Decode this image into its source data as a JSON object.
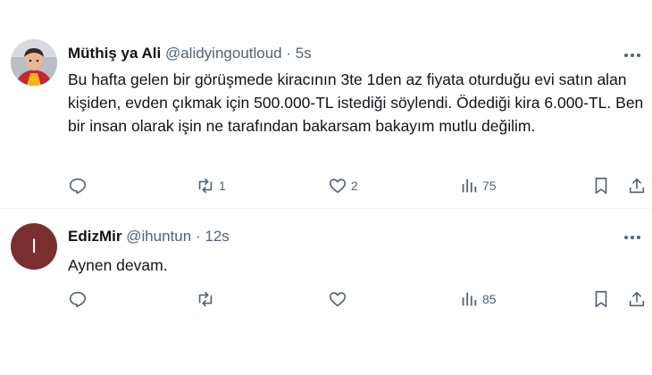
{
  "tweets": [
    {
      "name": "Müthiş ya Ali",
      "handle": "@alidyingoutloud",
      "separator": "·",
      "time": "5s",
      "text": "Bu hafta gelen bir görüşmede kiracının 3te 1den az fiyata oturduğu evi satın alan kişiden, evden çıkmak için 500.000-TL istediği söylendi. Ödediği kira 6.000-TL. Ben bir insan olarak işin ne tarafından bakarsam bakayım mutlu değilim.",
      "replies": "",
      "retweets": "1",
      "likes": "2",
      "views": "75"
    },
    {
      "name": "EdizMir",
      "handle": "@ihuntun",
      "separator": "·",
      "time": "12s",
      "avatar_letter": "I",
      "text": "Aynen devam.",
      "replies": "",
      "retweets": "",
      "likes": "",
      "views": "85"
    }
  ],
  "icons": {
    "reply": "reply-icon",
    "retweet": "retweet-icon",
    "like": "heart-icon",
    "views": "views-icon",
    "bookmark": "bookmark-icon",
    "share": "share-icon",
    "more": "more-icon"
  },
  "colors": {
    "text": "#0f1419",
    "secondary": "#536471",
    "divider": "#eff3f4",
    "avatar_bg": "#7a2f2f"
  }
}
